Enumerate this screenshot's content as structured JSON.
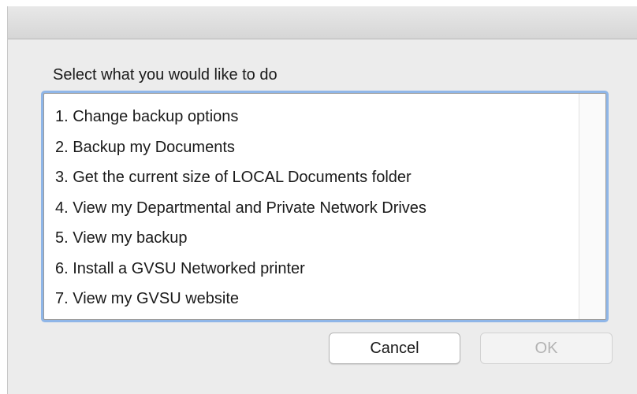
{
  "dialog": {
    "prompt": "Select what you would like to do",
    "items": [
      "1. Change backup options",
      "2. Backup my Documents",
      "3. Get the current size of LOCAL Documents folder",
      "4. View my Departmental and Private Network Drives",
      "5. View my backup",
      "6. Install a GVSU Networked printer",
      "7. View my GVSU website"
    ],
    "buttons": {
      "cancel": "Cancel",
      "ok": "OK"
    }
  },
  "colors": {
    "window_bg": "#ececec",
    "focus_ring": "#8fb6e8",
    "disabled_text": "#b3b3b3"
  }
}
